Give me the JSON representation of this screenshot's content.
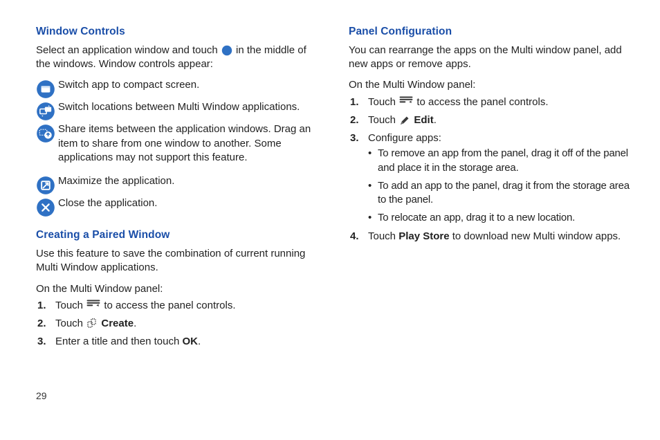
{
  "pageNumber": "29",
  "left": {
    "heading1": "Window Controls",
    "p1a": "Select an application window and touch ",
    "p1b": " in the middle of the windows. Window controls appear:",
    "rows": [
      "Switch app to compact screen.",
      "Switch locations between Multi Window applications.",
      "Share items between the application windows. Drag an item to share from one window to another. Some applications may not support this feature.",
      "Maximize the application.",
      "Close the application."
    ],
    "heading2": "Creating a Paired Window",
    "p2": "Use this feature to save the combination of current running Multi Window applications.",
    "p3": "On the Multi Window panel:",
    "ol": {
      "l1a": "Touch ",
      "l1b": " to access the panel controls.",
      "l2a": "Touch ",
      "l2b": "Create",
      "l2c": ".",
      "l3a": "Enter a title and then touch ",
      "l3b": "OK",
      "l3c": "."
    }
  },
  "right": {
    "heading": "Panel Configuration",
    "p1": "You can rearrange the apps on the Multi window panel, add new apps or remove apps.",
    "p2": "On the Multi Window panel:",
    "ol": {
      "l1a": "Touch ",
      "l1b": " to access the panel controls.",
      "l2a": "Touch ",
      "l2b": "Edit",
      "l2c": ".",
      "l3": "Configure apps:",
      "l4a": "Touch ",
      "l4b": "Play Store",
      "l4c": " to download new Multi window apps."
    },
    "ul": [
      "To remove an app from the panel, drag it off of the panel and place it in the storage area.",
      "To add an app to the panel, drag it from the storage area to the panel.",
      "To relocate an app, drag it to a new location."
    ]
  }
}
